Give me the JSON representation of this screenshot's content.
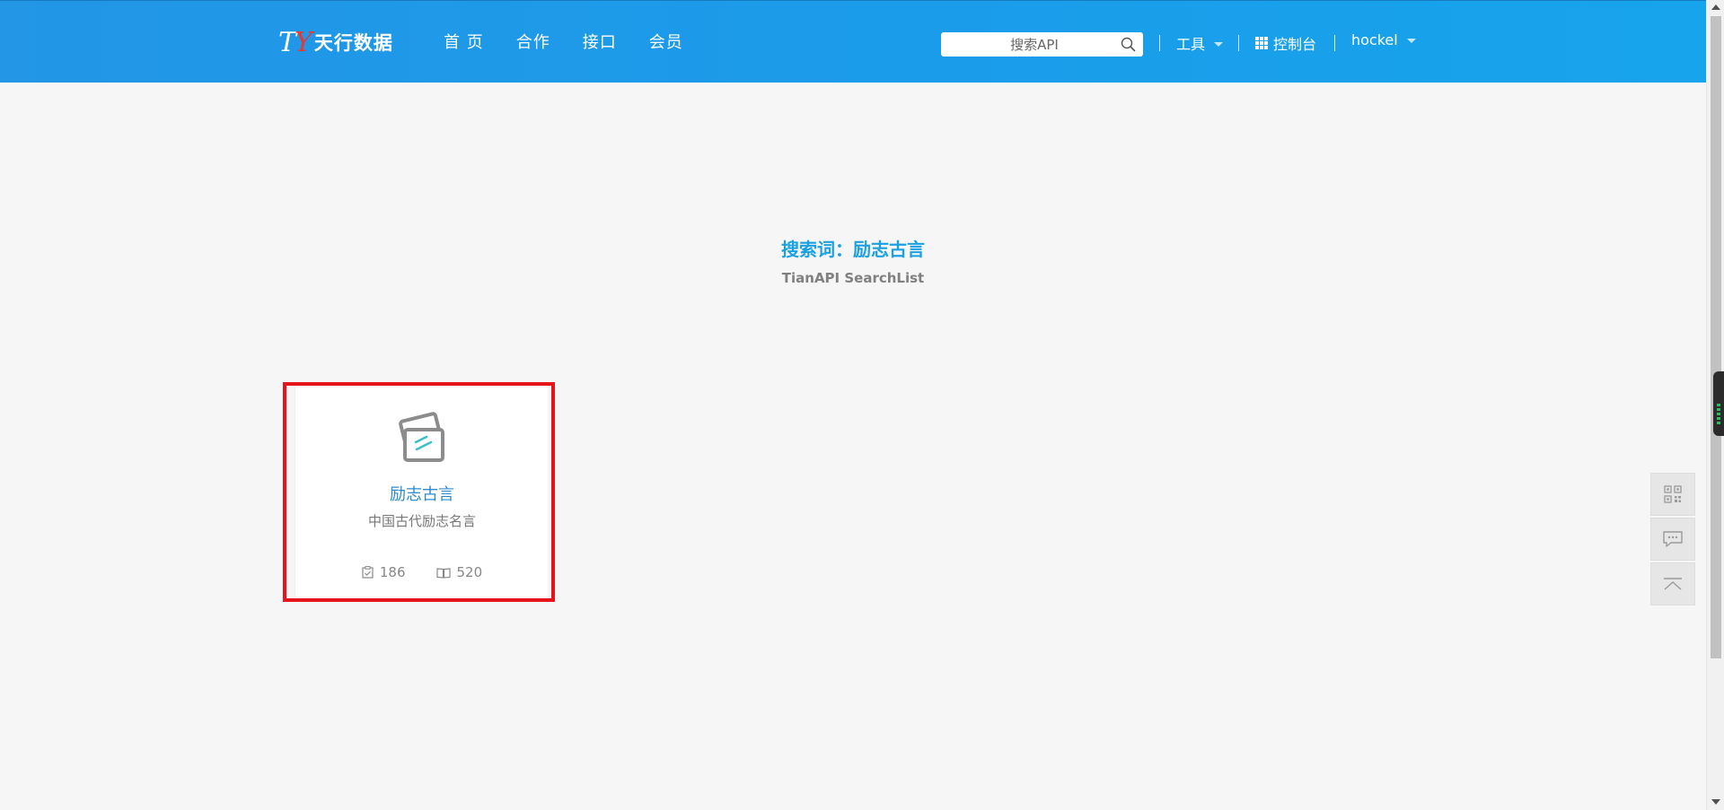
{
  "header": {
    "logo_mark_t": "T",
    "logo_mark_y": "Y",
    "logo_text": "天行数据",
    "nav": [
      {
        "label": "首 页"
      },
      {
        "label": "合作"
      },
      {
        "label": "接口"
      },
      {
        "label": "会员"
      }
    ],
    "search_placeholder": "搜索API",
    "tools_label": "工具",
    "console_label": "控制台",
    "user_label": "hockel"
  },
  "search": {
    "title": "搜索词：励志古言",
    "subtitle": "TianAPI SearchList"
  },
  "results": [
    {
      "title": "励志古言",
      "description": "中国古代励志名言",
      "stat_applies": "186",
      "stat_views": "520",
      "icon": "card-icon"
    }
  ],
  "float_tools": [
    {
      "icon": "qr-code-icon"
    },
    {
      "icon": "chat-icon"
    },
    {
      "icon": "back-to-top-icon"
    }
  ],
  "colors": {
    "header_bg": "#1a9cea",
    "accent": "#1ba1e2",
    "card_title": "#2d8bd0",
    "highlight_frame": "#e8141c"
  }
}
